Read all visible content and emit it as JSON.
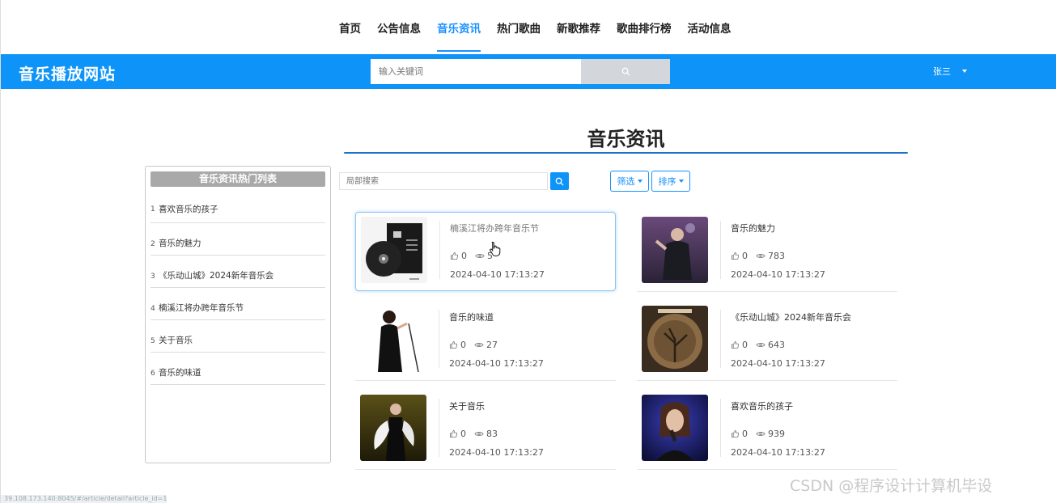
{
  "nav": {
    "items": [
      "首页",
      "公告信息",
      "音乐资讯",
      "热门歌曲",
      "新歌推荐",
      "歌曲排行榜",
      "活动信息"
    ],
    "active_index": 2
  },
  "header": {
    "site_title": "音乐播放网站",
    "search_placeholder": "输入关键词",
    "user_name": "张三"
  },
  "main": {
    "heading": "音乐资讯",
    "local_search_placeholder": "局部搜索",
    "filter_label": "筛选",
    "sort_label": "排序"
  },
  "sidebar": {
    "title": "音乐资讯热门列表",
    "items": [
      {
        "num": "1",
        "label": "喜欢音乐的孩子"
      },
      {
        "num": "2",
        "label": "音乐的魅力"
      },
      {
        "num": "3",
        "label": "《乐动山城》2024新年音乐会"
      },
      {
        "num": "4",
        "label": "楠溪江将办跨年音乐节"
      },
      {
        "num": "5",
        "label": "关于音乐"
      },
      {
        "num": "6",
        "label": "音乐的味道"
      }
    ]
  },
  "cards": [
    {
      "title": "楠溪江将办跨年音乐节",
      "likes": "0",
      "views": "5",
      "date": "2024-04-10 17:13:27"
    },
    {
      "title": "音乐的魅力",
      "likes": "0",
      "views": "783",
      "date": "2024-04-10 17:13:27"
    },
    {
      "title": "音乐的味道",
      "likes": "0",
      "views": "27",
      "date": "2024-04-10 17:13:27"
    },
    {
      "title": "《乐动山城》2024新年音乐会",
      "likes": "0",
      "views": "643",
      "date": "2024-04-10 17:13:27"
    },
    {
      "title": "关于音乐",
      "likes": "0",
      "views": "83",
      "date": "2024-04-10 17:13:27"
    },
    {
      "title": "喜欢音乐的孩子",
      "likes": "0",
      "views": "939",
      "date": "2024-04-10 17:13:27"
    }
  ],
  "status_url": "39.108.173.140:8045/#/article/detail?article_id=1",
  "watermark": "CSDN @程序设计计算机毕设",
  "colors": {
    "brand_blue": "#0e94f8",
    "accent": "#1890ff"
  }
}
